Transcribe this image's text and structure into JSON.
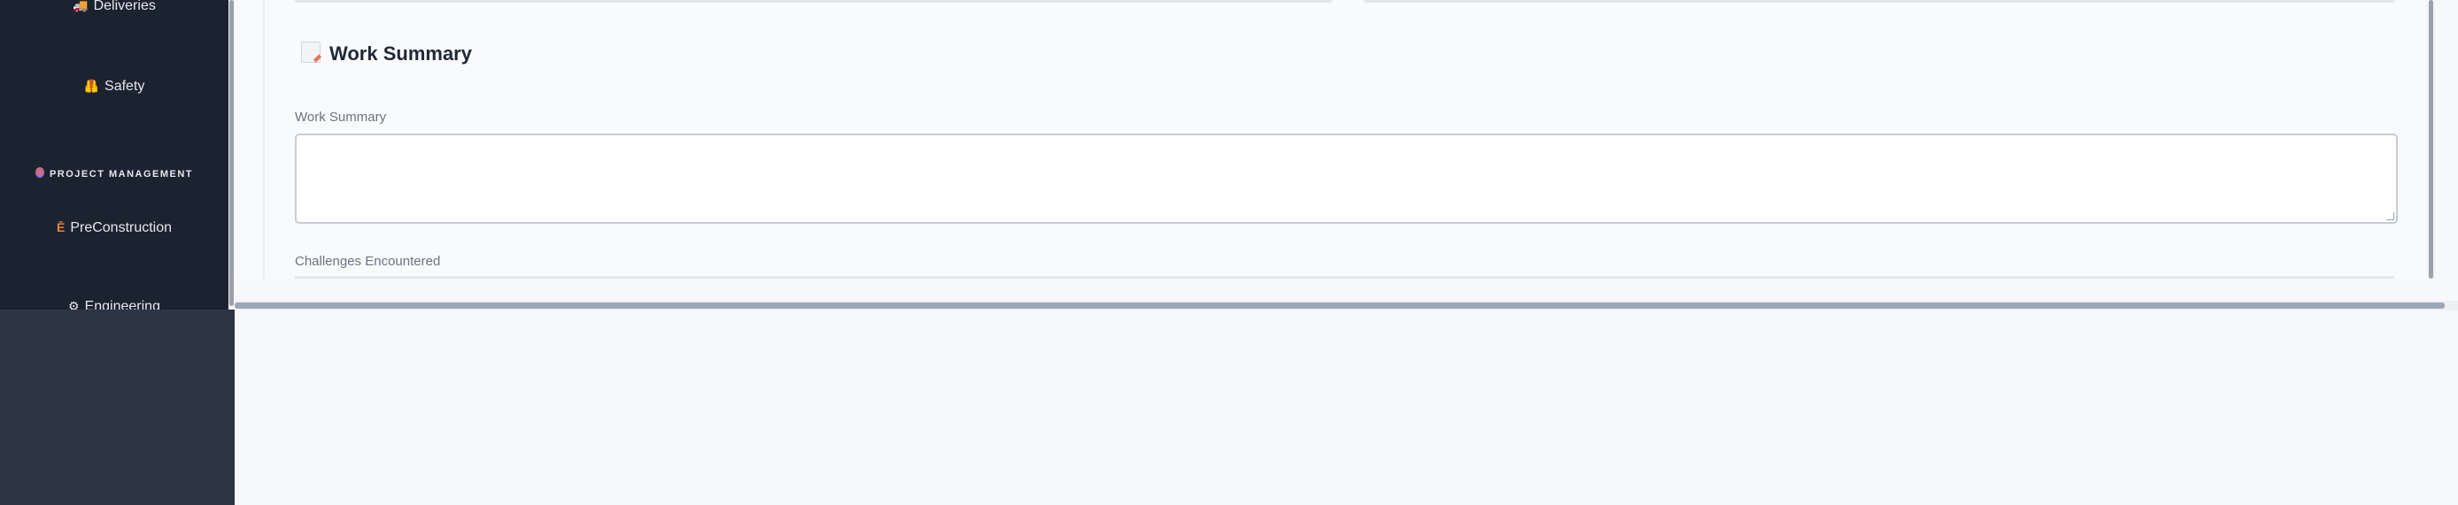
{
  "sidebar": {
    "items_top": [
      {
        "label": "Deliveries",
        "icon": "truck-icon"
      },
      {
        "label": "Safety",
        "icon": "safety-vest-icon"
      }
    ],
    "section": {
      "label": "PROJECT MANAGEMENT",
      "icon": "target-icon"
    },
    "items_pm": [
      {
        "label": "PreConstruction",
        "icon": "crane-icon"
      },
      {
        "label": "Engineering",
        "icon": "gear-icon"
      }
    ]
  },
  "main": {
    "section_title": "Work Summary",
    "fields": [
      {
        "label": "Work Summary",
        "value": "",
        "placeholder": ""
      },
      {
        "label": "Challenges Encountered",
        "value": "",
        "placeholder": ""
      }
    ]
  },
  "colors": {
    "sidebar_bg": "#1c2330",
    "sidebar_lower_bg": "#2c3544",
    "page_bg": "#f7f8fa",
    "title_text": "#1f2937",
    "label_text": "#6b7280"
  }
}
